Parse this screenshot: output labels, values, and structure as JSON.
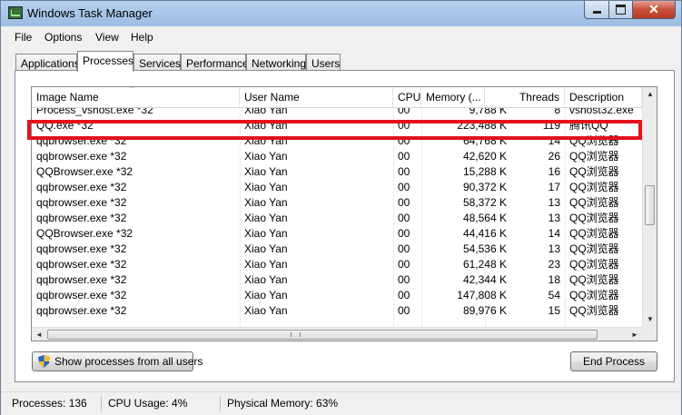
{
  "window": {
    "title": "Windows Task Manager",
    "close_glyph": "✕"
  },
  "menu": {
    "items": [
      "File",
      "Options",
      "View",
      "Help"
    ]
  },
  "tabs": [
    "Applications",
    "Processes",
    "Services",
    "Performance",
    "Networking",
    "Users"
  ],
  "active_tab": "Processes",
  "table": {
    "columns": [
      "Image Name",
      "User Name",
      "CPU",
      "Memory (...",
      "Threads",
      "Description"
    ],
    "sorted_column": "Image Name",
    "rows": [
      [
        "Process_vshost.exe *32",
        "Xiao Yan",
        "00",
        "9,788 K",
        "8",
        "vshost32.exe"
      ],
      [
        "QQ.exe *32",
        "Xiao Yan",
        "00",
        "223,488 K",
        "119",
        "腾讯QQ"
      ],
      [
        "qqbrowser.exe *32",
        "Xiao Yan",
        "00",
        "64,768 K",
        "14",
        "QQ浏览器"
      ],
      [
        "qqbrowser.exe *32",
        "Xiao Yan",
        "00",
        "42,620 K",
        "26",
        "QQ浏览器"
      ],
      [
        "QQBrowser.exe *32",
        "Xiao Yan",
        "00",
        "15,288 K",
        "16",
        "QQ浏览器"
      ],
      [
        "qqbrowser.exe *32",
        "Xiao Yan",
        "00",
        "90,372 K",
        "17",
        "QQ浏览器"
      ],
      [
        "qqbrowser.exe *32",
        "Xiao Yan",
        "00",
        "58,372 K",
        "13",
        "QQ浏览器"
      ],
      [
        "qqbrowser.exe *32",
        "Xiao Yan",
        "00",
        "48,564 K",
        "13",
        "QQ浏览器"
      ],
      [
        "QQBrowser.exe *32",
        "Xiao Yan",
        "00",
        "44,416 K",
        "14",
        "QQ浏览器"
      ],
      [
        "qqbrowser.exe *32",
        "Xiao Yan",
        "00",
        "54,536 K",
        "13",
        "QQ浏览器"
      ],
      [
        "qqbrowser.exe *32",
        "Xiao Yan",
        "00",
        "61,248 K",
        "23",
        "QQ浏览器"
      ],
      [
        "qqbrowser.exe *32",
        "Xiao Yan",
        "00",
        "42,344 K",
        "18",
        "QQ浏览器"
      ],
      [
        "qqbrowser.exe *32",
        "Xiao Yan",
        "00",
        "147,808 K",
        "54",
        "QQ浏览器"
      ],
      [
        "qqbrowser.exe *32",
        "Xiao Yan",
        "00",
        "89,976 K",
        "15",
        "QQ浏览器"
      ]
    ],
    "highlighted_row": 1,
    "highlight_color": "#e3121e"
  },
  "buttons": {
    "show_all": "Show processes from all users",
    "end_process": "End Process"
  },
  "status": {
    "processes": "Processes: 136",
    "cpu": "CPU Usage: 4%",
    "memory": "Physical Memory: 63%"
  },
  "icons": [
    "task-manager-icon",
    "minimize-icon",
    "maximize-icon",
    "close-icon",
    "uac-shield-icon",
    "sort-ascending-icon",
    "scroll-up-arrow-icon",
    "scroll-down-arrow-icon",
    "scroll-left-arrow-icon",
    "scroll-right-arrow-icon"
  ]
}
